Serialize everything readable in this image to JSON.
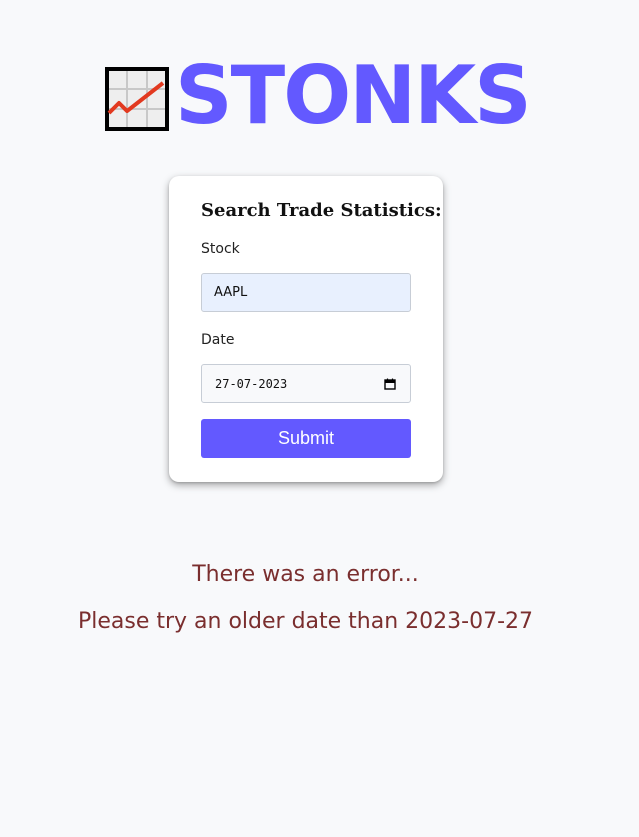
{
  "header": {
    "brand": "STONKS",
    "logo_icon": "chart-increasing-icon"
  },
  "form": {
    "title": "Search Trade Statistics:",
    "stock_label": "Stock",
    "stock_value": "AAPL",
    "date_label": "Date",
    "date_value": "27-07-2023",
    "submit_label": "Submit"
  },
  "error": {
    "title": "There was an error...",
    "detail": "Please try an older date than 2023-07-27"
  },
  "colors": {
    "accent": "#6359ff",
    "error": "#7a2e2e"
  }
}
